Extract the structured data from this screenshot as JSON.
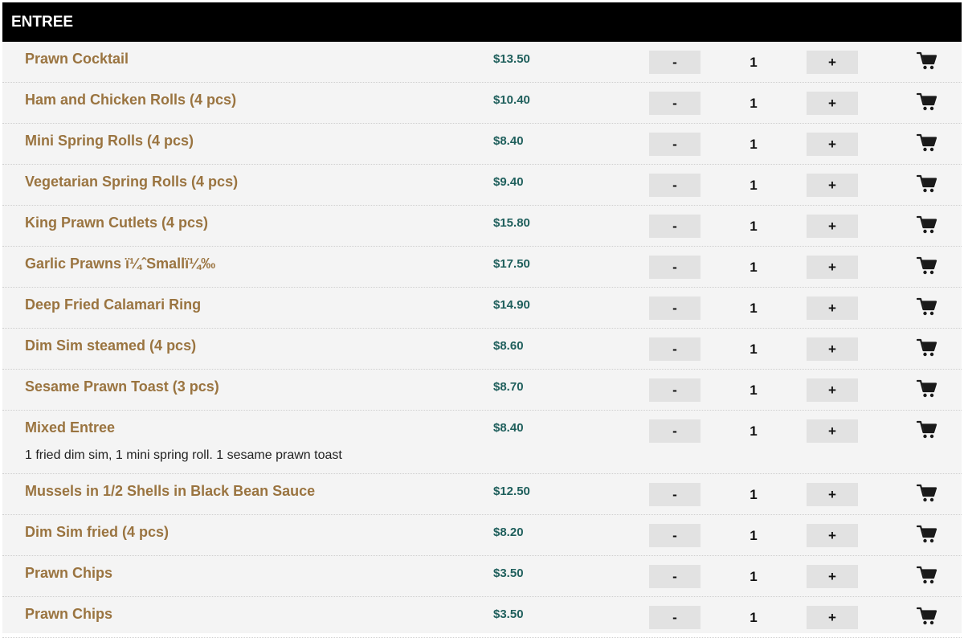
{
  "section": {
    "title": "ENTREE"
  },
  "controls": {
    "minus_label": "-",
    "plus_label": "+"
  },
  "items": [
    {
      "name": "Prawn Cocktail",
      "price": "$13.50",
      "qty": "1"
    },
    {
      "name": "Ham and Chicken Rolls (4 pcs)",
      "price": "$10.40",
      "qty": "1"
    },
    {
      "name": "Mini Spring Rolls (4 pcs)",
      "price": "$8.40",
      "qty": "1"
    },
    {
      "name": "Vegetarian Spring Rolls (4 pcs)",
      "price": "$9.40",
      "qty": "1"
    },
    {
      "name": "King Prawn Cutlets (4 pcs)",
      "price": "$15.80",
      "qty": "1"
    },
    {
      "name": "Garlic Prawns ï¼ˆSmallï¼‰",
      "price": "$17.50",
      "qty": "1"
    },
    {
      "name": "Deep Fried Calamari Ring",
      "price": "$14.90",
      "qty": "1"
    },
    {
      "name": "Dim Sim steamed (4 pcs)",
      "price": "$8.60",
      "qty": "1"
    },
    {
      "name": "Sesame Prawn Toast (3 pcs)",
      "price": "$8.70",
      "qty": "1"
    },
    {
      "name": "Mixed Entree",
      "price": "$8.40",
      "qty": "1",
      "description": "1 fried dim sim, 1 mini spring roll. 1 sesame prawn toast"
    },
    {
      "name": "Mussels in 1/2 Shells in Black Bean Sauce",
      "price": "$12.50",
      "qty": "1"
    },
    {
      "name": "Dim Sim fried (4 pcs)",
      "price": "$8.20",
      "qty": "1"
    },
    {
      "name": "Prawn Chips",
      "price": "$3.50",
      "qty": "1"
    },
    {
      "name": "Prawn Chips",
      "price": "$3.50",
      "qty": "1"
    }
  ],
  "icons": {
    "cart": "shopping-cart-icon"
  },
  "colors": {
    "header_bg": "#000000",
    "item_name": "#9a7440",
    "price": "#1f5f5c",
    "button_bg": "#e2e2e2",
    "row_bg": "#f4f4f4"
  }
}
